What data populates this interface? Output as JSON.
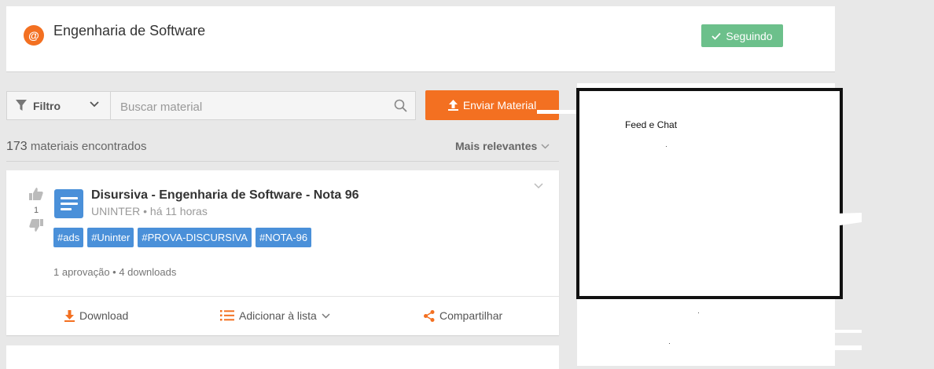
{
  "header": {
    "logo_glyph": "@",
    "title": "Engenharia de Software",
    "follow_label": "Seguindo",
    "follow_color": "#6cc08b",
    "brand_color": "#f37021"
  },
  "toolbar": {
    "filter_label": "Filtro",
    "search_placeholder": "Buscar material",
    "send_label": "Enviar Material"
  },
  "results": {
    "count": "173",
    "count_label": "materiais encontrados",
    "sort_label": "Mais relevantes"
  },
  "materials": [
    {
      "title": "Disursiva - Engenharia de Software - Nota 96",
      "source": "UNINTER",
      "time": "há 11 horas",
      "votes": "1",
      "tags": [
        "#ads",
        "#Uninter",
        "#PROVA-DISCURSIVA",
        "#NOTA-96"
      ],
      "approvals": "1 aprovação",
      "downloads": "4 downloads",
      "actions": {
        "download": "Download",
        "add_to_list": "Adicionar à lista",
        "share": "Compartilhar"
      }
    }
  ],
  "sidebar": {
    "feed_label": "Feed e Chat"
  },
  "colors": {
    "tag_blue": "#4a90d9",
    "accent_orange": "#f37021"
  }
}
